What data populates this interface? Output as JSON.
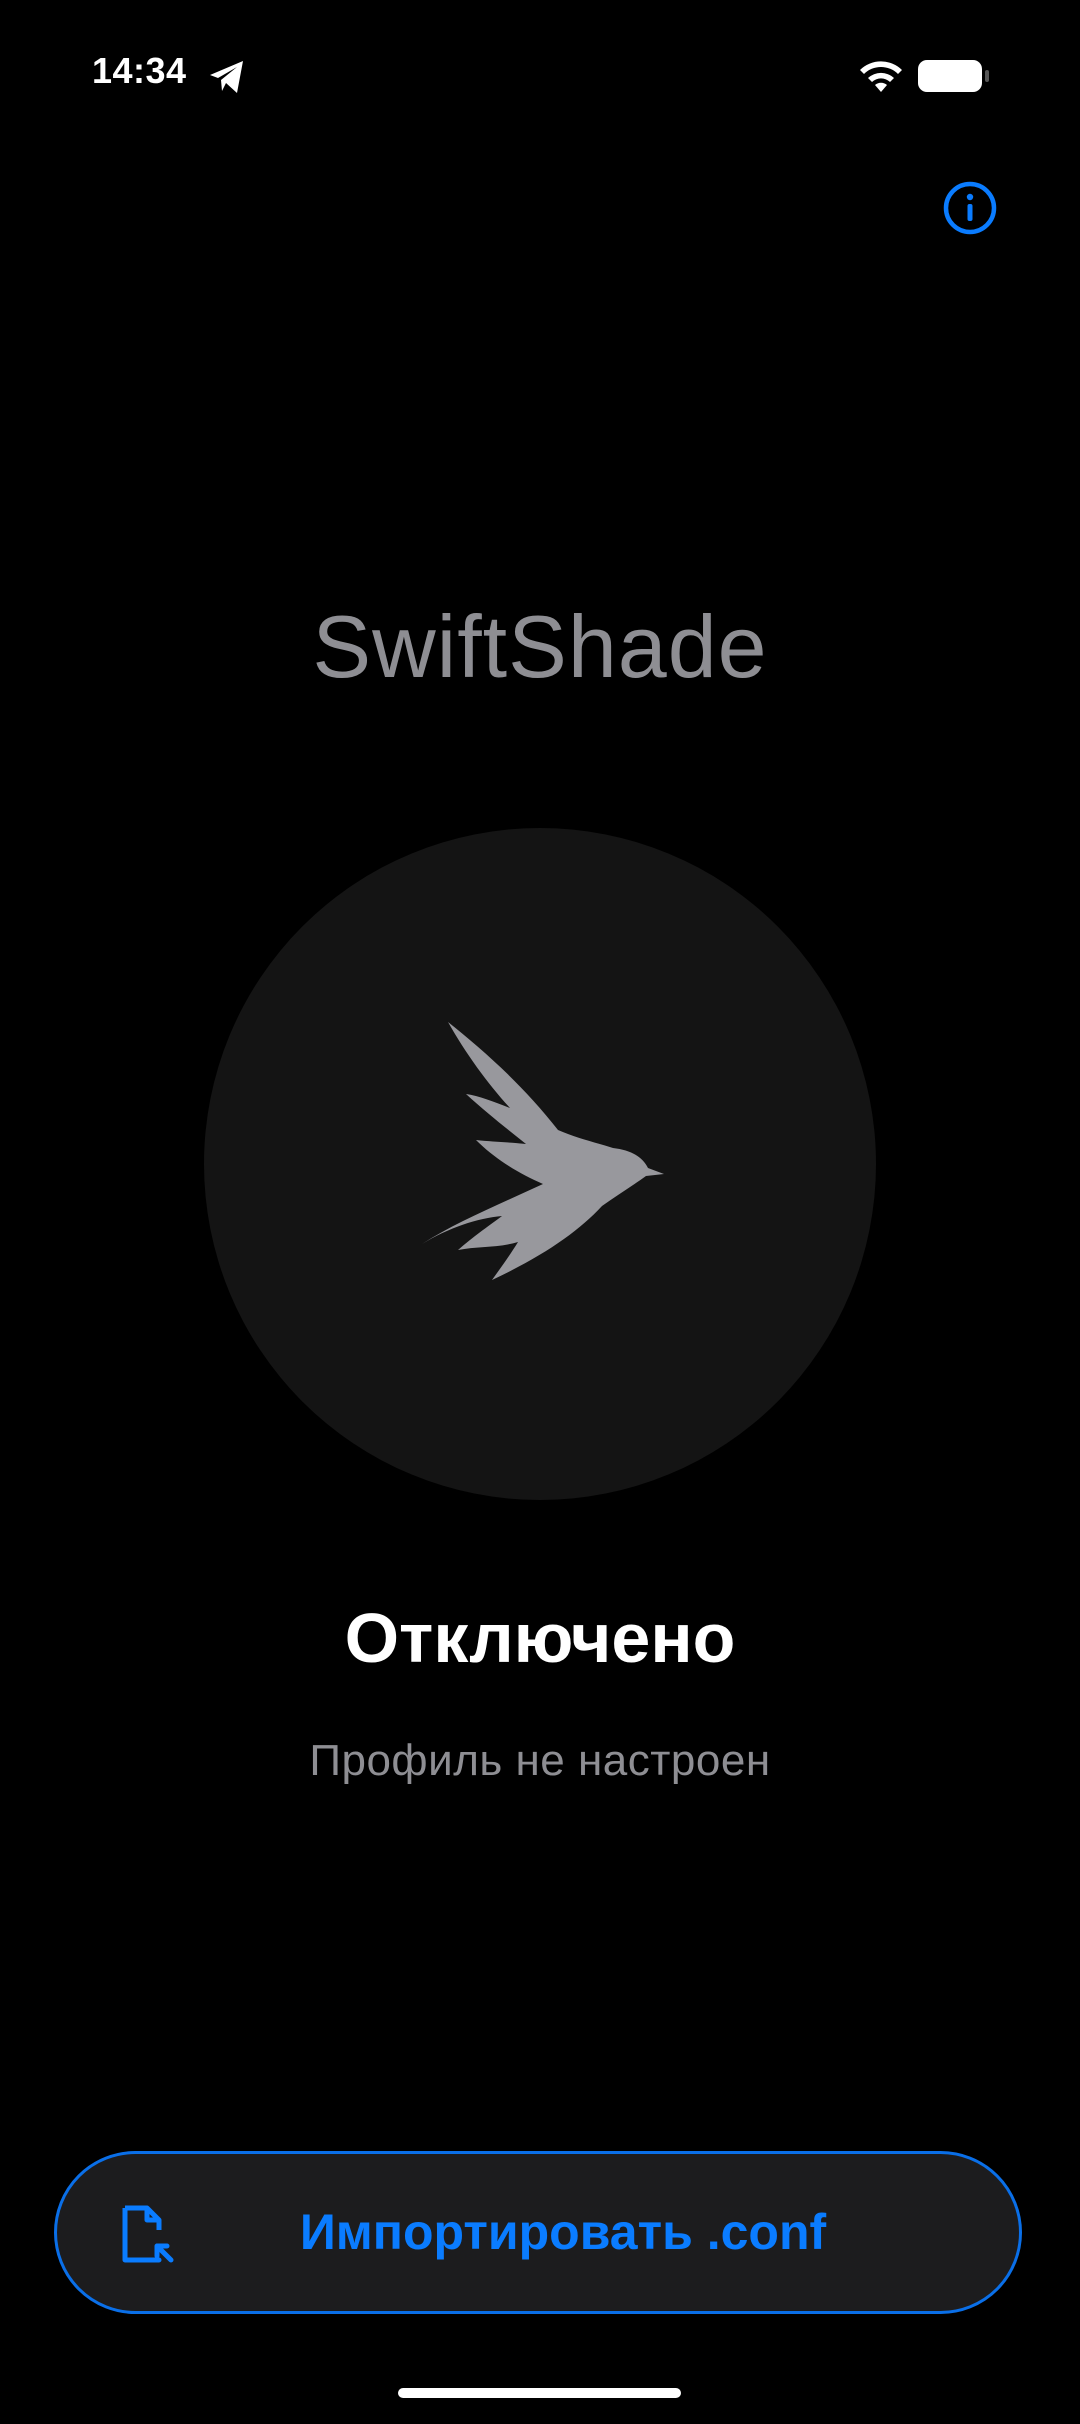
{
  "status_bar": {
    "time": "14:34",
    "icons": [
      "telegram-icon",
      "wifi-icon",
      "battery-icon"
    ]
  },
  "header": {
    "info_icon": "info-icon"
  },
  "app": {
    "title": "SwiftShade",
    "logo_icon": "swift-bird-icon"
  },
  "connection": {
    "state_label": "Отключено",
    "profile_label": "Профиль не настроен"
  },
  "actions": {
    "import_label": "Импортировать .conf",
    "import_icon": "file-import-icon"
  },
  "colors": {
    "background": "#000000",
    "accent": "#0a7cff",
    "circle": "#141414",
    "muted_text": "#8e8e93",
    "button_bg": "#1c1c1e"
  }
}
